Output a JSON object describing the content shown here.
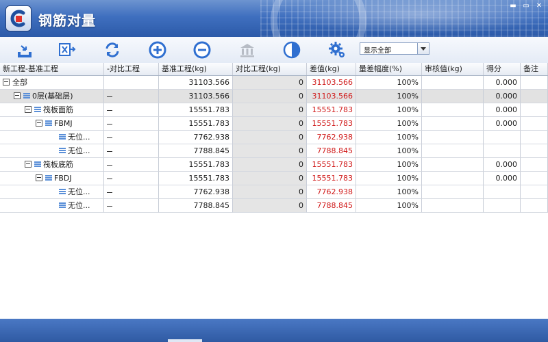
{
  "window": {
    "title": "钢筋对量",
    "min": "▬",
    "max": "▭",
    "close": "✕"
  },
  "toolbar": {
    "buttons": [
      {
        "icon": "export-tray-icon"
      },
      {
        "icon": "export-excel-icon"
      },
      {
        "icon": "refresh-icon"
      },
      {
        "icon": "expand-plus-icon"
      },
      {
        "icon": "collapse-minus-icon"
      },
      {
        "icon": "building-icon"
      },
      {
        "icon": "half-circle-icon"
      },
      {
        "icon": "settings-gear-icon"
      }
    ],
    "filter_value": "显示全部"
  },
  "grid": {
    "headers": [
      "新工程-基准工程",
      "-对比工程",
      "基准工程(kg)",
      "对比工程(kg)",
      "差值(kg)",
      "量差幅度(%)",
      "审核值(kg)",
      "得分",
      "备注"
    ],
    "rows": [
      {
        "name": "全部",
        "toggle": true,
        "node": false,
        "compare_dash": false,
        "base": "31103.566",
        "compare": "0",
        "diff": "31103.566",
        "ratio": "100%",
        "audit": "",
        "score": "0.000",
        "note": ""
      },
      {
        "name": "0层(基础层)",
        "toggle": true,
        "node": true,
        "compare_dash": true,
        "base": "31103.566",
        "compare": "0",
        "diff": "31103.566",
        "ratio": "100%",
        "audit": "",
        "score": "0.000",
        "note": ""
      },
      {
        "name": "筏板面筋",
        "toggle": true,
        "node": true,
        "compare_dash": true,
        "base": "15551.783",
        "compare": "0",
        "diff": "15551.783",
        "ratio": "100%",
        "audit": "",
        "score": "0.000",
        "note": ""
      },
      {
        "name": "FBMJ",
        "toggle": true,
        "node": true,
        "compare_dash": true,
        "base": "15551.783",
        "compare": "0",
        "diff": "15551.783",
        "ratio": "100%",
        "audit": "",
        "score": "0.000",
        "note": ""
      },
      {
        "name": "无位...",
        "toggle": false,
        "node": true,
        "compare_dash": true,
        "base": "7762.938",
        "compare": "0",
        "diff": "7762.938",
        "ratio": "100%",
        "audit": "",
        "score": "",
        "note": ""
      },
      {
        "name": "无位...",
        "toggle": false,
        "node": true,
        "compare_dash": true,
        "base": "7788.845",
        "compare": "0",
        "diff": "7788.845",
        "ratio": "100%",
        "audit": "",
        "score": "",
        "note": ""
      },
      {
        "name": "筏板底筋",
        "toggle": true,
        "node": true,
        "compare_dash": true,
        "base": "15551.783",
        "compare": "0",
        "diff": "15551.783",
        "ratio": "100%",
        "audit": "",
        "score": "0.000",
        "note": ""
      },
      {
        "name": "FBDJ",
        "toggle": true,
        "node": true,
        "compare_dash": true,
        "base": "15551.783",
        "compare": "0",
        "diff": "15551.783",
        "ratio": "100%",
        "audit": "",
        "score": "0.000",
        "note": ""
      },
      {
        "name": "无位...",
        "toggle": false,
        "node": true,
        "compare_dash": true,
        "base": "7762.938",
        "compare": "0",
        "diff": "7762.938",
        "ratio": "100%",
        "audit": "",
        "score": "",
        "note": ""
      },
      {
        "name": "无位...",
        "toggle": false,
        "node": true,
        "compare_dash": true,
        "base": "7788.845",
        "compare": "0",
        "diff": "7788.845",
        "ratio": "100%",
        "audit": "",
        "score": "",
        "note": ""
      }
    ]
  },
  "colors": {
    "diff_text": "#d01818",
    "toolbar_icon": "#2f6fd0",
    "selected_row": "#e2e2e2"
  }
}
